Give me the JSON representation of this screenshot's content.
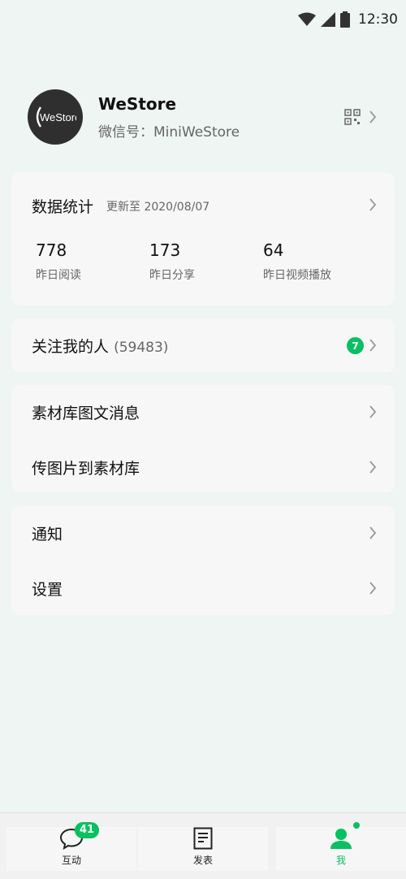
{
  "status_bar": {
    "time": "12:30"
  },
  "profile": {
    "logo_text": "WeStore",
    "name": "WeStore",
    "wechat_id": "微信号：MiniWeStore"
  },
  "stats": {
    "title": "数据统计",
    "updated": "更新至 2020/08/07",
    "items": [
      {
        "value": "778",
        "label": "昨日阅读"
      },
      {
        "value": "173",
        "label": "昨日分享"
      },
      {
        "value": "64",
        "label": "昨日视频播放"
      }
    ]
  },
  "follow": {
    "label": "关注我的人",
    "count": "(59483)",
    "badge": "7"
  },
  "material": {
    "items": [
      {
        "label": "素材库图文消息"
      },
      {
        "label": "传图片到素材库"
      }
    ]
  },
  "settings": {
    "items": [
      {
        "label": "通知"
      },
      {
        "label": "设置"
      }
    ]
  },
  "tabbar": {
    "tabs": [
      {
        "label": "互动",
        "icon": "chat-bubble-icon",
        "badge": "41"
      },
      {
        "label": "发表",
        "icon": "document-icon"
      },
      {
        "label": "我",
        "icon": "person-icon",
        "active": true
      }
    ]
  },
  "colors": {
    "accent": "#07c160",
    "background": "#eef5f2",
    "card": "#f7f7f7"
  }
}
